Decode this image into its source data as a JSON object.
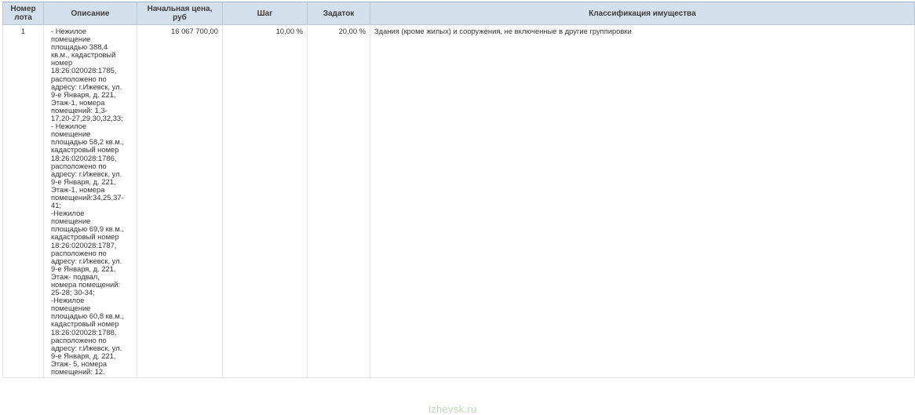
{
  "table": {
    "headers": {
      "lot_number": "Номер лота",
      "description": "Описание",
      "start_price": "Начальная цена, руб",
      "step": "Шаг",
      "deposit": "Задаток",
      "classification": "Классификация имущества"
    },
    "rows": [
      {
        "lot_number": "1",
        "description": "- Нежилое\nпомещение\nплощадью 388,4\nкв.м., кадастровый\nномер\n18:26:020028:1785,\nрасположено по\nадресу: г.Ижевск, ул.\n9-е Января, д. 221,\nЭтаж-1, номера\nпомещений: 1,3-\n17,20-27,29,30,32,33;\n- Нежилое\nпомещение\nплощадью 58,2 кв.м.,\nкадастровый номер\n18:26:020028:1786,\nрасположено по\nадресу: г.Ижевск, ул.\n9-е Января, д. 221,\nЭтаж-1, номера\nпомещений:34,25,37-\n41;\n-Нежилое\nпомещение\nплощадью 69,9 кв.м.,\nкадастровый номер\n18:26:020028:1787,\nрасположено по\nадресу: г.Ижевск, ул.\n9-е Января, д. 221,\nЭтаж- подвал,\nномера помещений:\n25-28; 30-34;\n-Нежилое\nпомещение\nплощадью 60,8 кв.м.,\nкадастровый номер\n18:26:020028:1788,\nрасположено по\nадресу: г.Ижевск, ул.\n9-е Января, д. 221,\nЭтаж- 5, номера\nпомещений: 12.",
        "start_price": "16 067 700,00",
        "step": "10,00 %",
        "deposit": "20,00 %",
        "classification": "Здания (кроме жилых) и сооружения, не включенные в другие группировки"
      }
    ]
  },
  "watermark": "izhevsk.ru"
}
